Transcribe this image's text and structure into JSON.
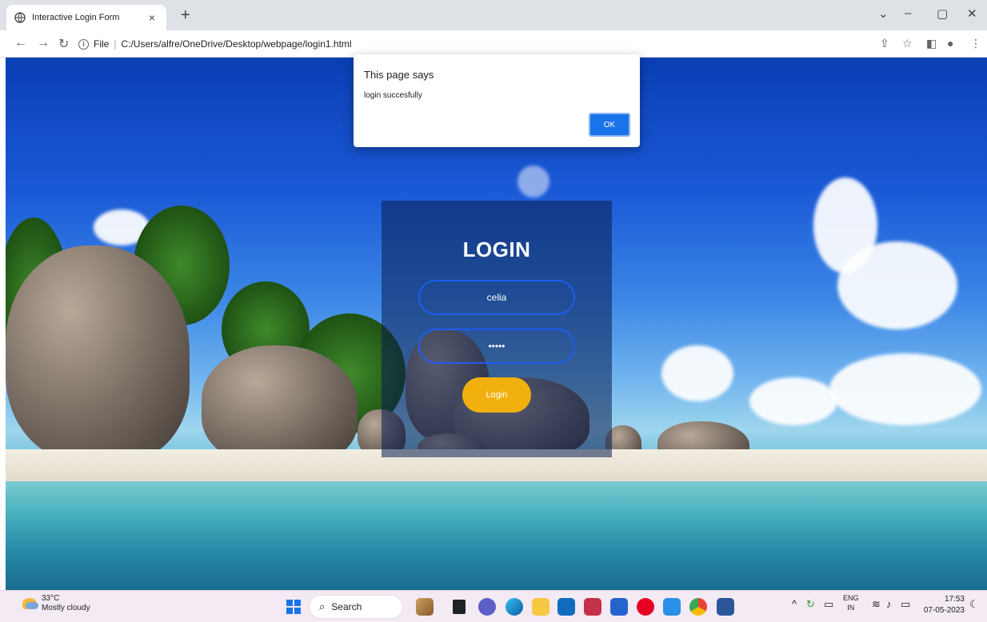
{
  "browser": {
    "tab_title": "Interactive Login Form",
    "tab_close": "×",
    "new_tab": "+",
    "file_label": "File",
    "url": "C:/Users/alfre/OneDrive/Desktop/webpage/login1.html"
  },
  "dialog": {
    "title": "This page says",
    "message": "login succesfully",
    "ok_label": "OK"
  },
  "login": {
    "heading": "LOGIN",
    "username_value": "celia",
    "password_value": "•••••",
    "button_label": "Login"
  },
  "taskbar": {
    "weather_temp": "33°C",
    "weather_desc": "Mostly cloudy",
    "search_label": "Search",
    "lang_line1": "ENG",
    "lang_line2": "IN",
    "time": "17:53",
    "date": "07-05-2023"
  },
  "colors": {
    "accent": "#1a73e8",
    "login_button": "#f1b00d",
    "field_border": "#1f5cf2"
  }
}
